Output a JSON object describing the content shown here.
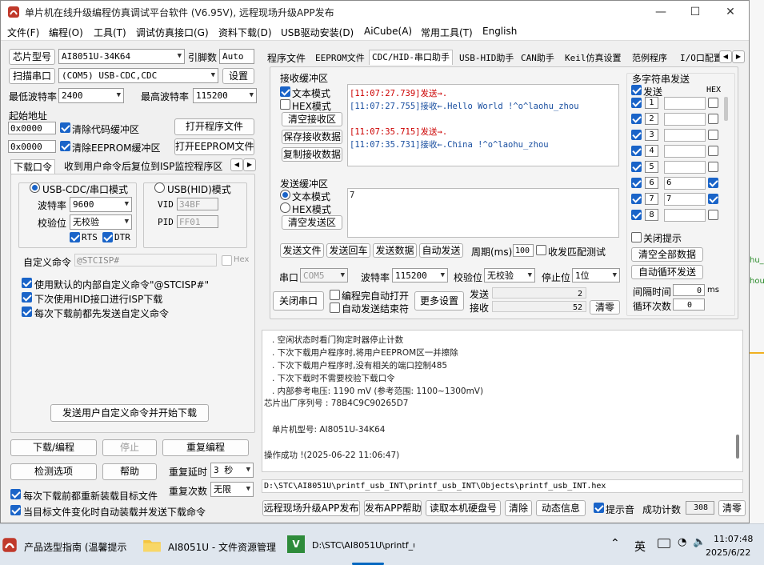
{
  "window": {
    "title": "单片机在线升级编程仿真调试平台软件 (V6.95V), 远程现场升级APP发布"
  },
  "menu": [
    "文件(F)",
    "编程(O)",
    "工具(T)",
    "调试仿真接口(G)",
    "资料下载(D)",
    "USB驱动安装(D)",
    "AiCube(A)",
    "常用工具(T)",
    "English"
  ],
  "left": {
    "chip_label": "芯片型号",
    "chip_value": "AI8051U-34K64",
    "pin_label": "引脚数",
    "pin_value": "Auto",
    "scan_btn": "扫描串口",
    "port_value": "(COM5) USB-CDC,CDC",
    "settings_btn": "设置",
    "min_baud_label": "最低波特率",
    "min_baud": "2400",
    "max_baud_label": "最高波特率",
    "max_baud": "115200",
    "start_addr_label": "起始地址",
    "addr1": "0x0000",
    "clear_code": "清除代码缓冲区",
    "open_prog_btn": "打开程序文件",
    "addr2": "0x0000",
    "clear_eeprom": "清除EEPROM缓冲区",
    "open_eeprom_btn": "打开EEPROM文件",
    "tab1": "下载口令",
    "tab2": "收到用户命令后复位到ISP监控程序区",
    "cdc_mode": "USB-CDC/串口模式",
    "hid_mode": "USB(HID)模式",
    "baud_label": "波特率",
    "baud_value": "9600",
    "parity_label": "校验位",
    "parity_value": "无校验",
    "vid_label": "VID",
    "vid": "34BF",
    "pid_label": "PID",
    "pid": "FF01",
    "rts": "RTS",
    "dtr": "DTR",
    "custom_label": "自定义命令",
    "custom_value": "@STCISP#",
    "hex_label": "Hex",
    "opt1": "使用默认的内部自定义命令\"@STCISP#\"",
    "opt2": "下次使用HID接口进行ISP下载",
    "opt3": "每次下载前都先发送自定义命令",
    "send_custom_btn": "发送用户自定义命令并开始下载",
    "download_btn": "下载/编程",
    "stop_btn": "停止",
    "reprog_btn": "重复编程",
    "check_btn": "检测选项",
    "help_btn": "帮助",
    "delay_label": "重复延时",
    "delay_value": "3 秒",
    "count_label": "重复次数",
    "count_value": "无限",
    "reload_opt": "每次下载前都重新装载目标文件",
    "auto_opt": "当目标文件变化时自动装载并发送下载命令"
  },
  "right": {
    "tabs": [
      "程序文件",
      "EEPROM文件",
      "CDC/HID-串口助手",
      "USB-HID助手",
      "CAN助手",
      "Keil仿真设置",
      "范例程序",
      "I/O口配置"
    ],
    "recv_title": "接收缓冲区",
    "text_mode": "文本模式",
    "hex_mode": "HEX模式",
    "clear_recv": "清空接收区",
    "save_recv": "保存接收数据",
    "copy_recv": "复制接收数据",
    "recv_lines": [
      {
        "ts": "[11:07:27.739]",
        "act": "发送→",
        "msg": "."
      },
      {
        "ts": "[11:07:27.755]",
        "act": "接收←",
        "msg": ".Hello World !^o^laohu_zhou"
      },
      {
        "ts": "[11:07:35.715]",
        "act": "发送→",
        "msg": "."
      },
      {
        "ts": "[11:07:35.731]",
        "act": "接收←",
        "msg": ".China !^o^laohu_zhou"
      }
    ],
    "send_title": "发送缓冲区",
    "send_text": "7",
    "clear_send": "清空发送区",
    "send_file": "发送文件",
    "send_enter": "发送回车",
    "send_data": "发送数据",
    "auto_send": "自动发送",
    "period_label": "周期(ms)",
    "period": "100",
    "match_label": "收发匹配测试",
    "multi_title": "多字符串发送",
    "multi_send": "发送",
    "multi_hex": "HEX",
    "multi_rows": [
      {
        "n": "1",
        "v": ""
      },
      {
        "n": "2",
        "v": ""
      },
      {
        "n": "3",
        "v": ""
      },
      {
        "n": "4",
        "v": ""
      },
      {
        "n": "5",
        "v": ""
      },
      {
        "n": "6",
        "v": "6"
      },
      {
        "n": "7",
        "v": "7"
      },
      {
        "n": "8",
        "v": ""
      }
    ],
    "close_tip": "关闭提示",
    "clear_all": "清空全部数据",
    "auto_loop": "自动循环发送",
    "interval_label": "间隔时间",
    "interval": "0",
    "interval_unit": "ms",
    "loop_label": "循环次数",
    "loop": "0",
    "port_label": "串口",
    "port": "COM5",
    "baud_label": "波特率",
    "baud": "115200",
    "parity_label": "校验位",
    "parity": "无校验",
    "stop_label": "停止位",
    "stop": "1位",
    "close_port": "关闭串口",
    "opt_open": "编程完自动打开",
    "opt_close": "自动发送结束符",
    "more_btn": "更多设置",
    "sent_label": "发送",
    "sent": "2",
    "recv_label": "接收",
    "recv": "52",
    "clear_btn": "清零"
  },
  "log": {
    "lines": [
      ". 空闲状态时看门狗定时器停止计数",
      ". 下次下载用户程序时,将用户EEPROM区一并擦除",
      ". 下次下载用户程序时,没有相关的端口控制485",
      ". 下次下载时不需要校验下载口令",
      ". 内部参考电压: 1190 mV (参考范围: 1100~1300mV)"
    ],
    "serial": "芯片出厂序列号 : 78B4C9C90265D7",
    "mcu": "单片机型号: AI8051U-34K64",
    "success": "操作成功 !(2025-06-22 11:06:47)",
    "path": "D:\\STC\\AI8051U\\printf_usb_INT\\printf_usb_INT\\Objects\\printf_usb_INT.hex"
  },
  "bottom": {
    "remote_btn": "远程现场升级APP发布",
    "publish_help": "发布APP帮助",
    "read_disk": "读取本机硬盘号",
    "clear": "清除",
    "dynamic": "动态信息",
    "sound": "提示音",
    "success_label": "成功计数",
    "success_count": "308",
    "zero": "清零"
  },
  "taskbar": {
    "item1": "产品选型指南 (温馨提示",
    "item2": "AI8051U - 文件资源管理",
    "item3": "D:\\STC\\AI8051U\\printf_u",
    "ime": "英",
    "time": "11:07:48",
    "date": "2025/6/22"
  },
  "bg_text": [
    "hu_",
    "hou"
  ]
}
